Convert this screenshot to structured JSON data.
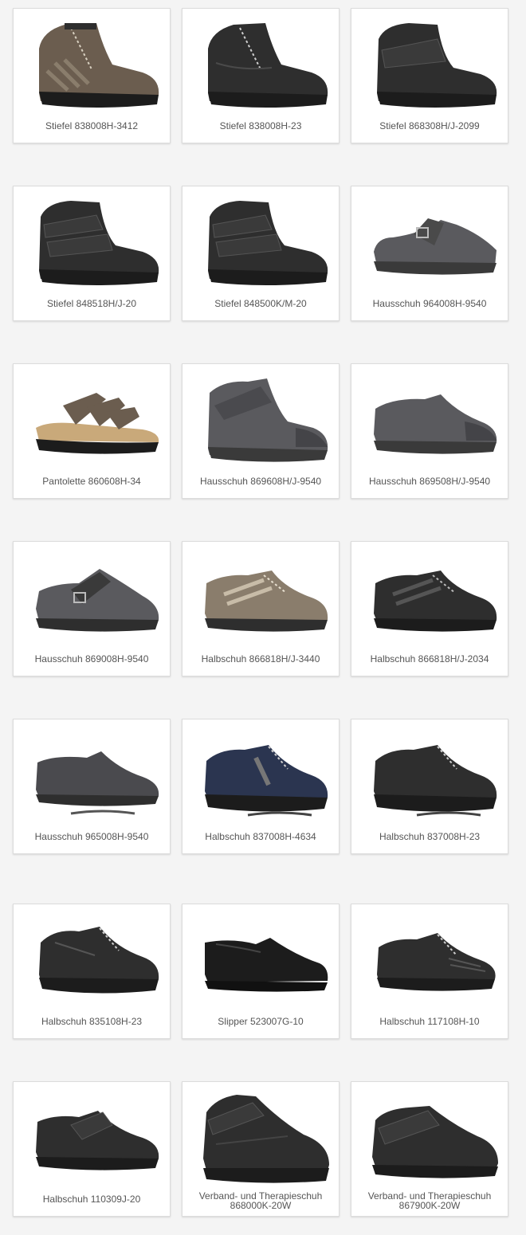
{
  "products": [
    {
      "name": "Stiefel 838008H-3412",
      "image": "brown-grey lace-up boot with side zip",
      "icon": "ankle-boot-lace-icon",
      "tone": "brown"
    },
    {
      "name": "Stiefel 838008H-23",
      "image": "black lace-up boot with side zip",
      "icon": "ankle-boot-lace-icon",
      "tone": "black"
    },
    {
      "name": "Stiefel 868308H/J-2099",
      "image": "black boot with wide velcro strap",
      "icon": "ankle-boot-strap-icon",
      "tone": "black"
    },
    {
      "name": "Stiefel 848518H/J-20",
      "image": "black boot with two velcro straps",
      "icon": "ankle-boot-strap-icon",
      "tone": "black"
    },
    {
      "name": "Stiefel 848500K/M-20",
      "image": "black boot with two velcro straps",
      "icon": "ankle-boot-strap-icon",
      "tone": "black"
    },
    {
      "name": "Hausschuh 964008H-9540",
      "image": "grey felt slipper with buckle strap",
      "icon": "slipper-buckle-icon",
      "tone": "felt"
    },
    {
      "name": "Pantolette 860608H-34",
      "image": "brown open sandal with three straps",
      "icon": "sandal-icon",
      "tone": "brown"
    },
    {
      "name": "Hausschuh 869608H/J-9540",
      "image": "grey felt high slipper with strap",
      "icon": "felt-boot-icon",
      "tone": "felt"
    },
    {
      "name": "Hausschuh 869508H/J-9540",
      "image": "grey felt slipper",
      "icon": "felt-slipper-icon",
      "tone": "felt"
    },
    {
      "name": "Hausschuh 869008H-9540",
      "image": "grey felt clog with buckle",
      "icon": "slipper-buckle-icon",
      "tone": "felt"
    },
    {
      "name": "Halbschuh 866818H/J-3440",
      "image": "taupe lace-up shoe",
      "icon": "lace-shoe-icon",
      "tone": "taupe"
    },
    {
      "name": "Halbschuh 866818H/J-2034",
      "image": "black lace-up shoe",
      "icon": "lace-shoe-icon",
      "tone": "black"
    },
    {
      "name": "Hausschuh 965008H-9540",
      "image": "dark felt slip-on slipper",
      "icon": "felt-slipper-icon",
      "tone": "felt"
    },
    {
      "name": "Halbschuh 837008H-4634",
      "image": "navy lace-up sneaker",
      "icon": "sneaker-icon",
      "tone": "navy"
    },
    {
      "name": "Halbschuh 837008H-23",
      "image": "black lace-up sneaker",
      "icon": "sneaker-icon",
      "tone": "black"
    },
    {
      "name": "Halbschuh 835108H-23",
      "image": "black lace-up shoe",
      "icon": "lace-shoe-icon",
      "tone": "black"
    },
    {
      "name": "Slipper 523007G-10",
      "image": "black leather loafer",
      "icon": "loafer-icon",
      "tone": "black"
    },
    {
      "name": "Halbschuh 117108H-10",
      "image": "black lace-up shoe",
      "icon": "lace-shoe-icon",
      "tone": "black"
    },
    {
      "name": "Halbschuh 110309J-20",
      "image": "black velcro shoe",
      "icon": "strap-shoe-icon",
      "tone": "black"
    },
    {
      "name_lines": [
        "Verband- und Therapieschuh",
        "868000K-20W"
      ],
      "image": "black therapy shoe with velcro strap",
      "icon": "therapy-shoe-icon",
      "tone": "black"
    },
    {
      "name_lines": [
        "Verband- und Therapieschuh",
        "867900K-20W"
      ],
      "image": "black therapy shoe with velcro strap",
      "icon": "therapy-shoe-icon",
      "tone": "black"
    }
  ],
  "colors": {
    "background": "#f4f4f4",
    "card": "#ffffff",
    "label": "#555555",
    "black_leather": "#2e2e2e",
    "brown_leather": "#6b5d4f",
    "felt": "#5a5a5e",
    "navy": "#2b3550",
    "taupe": "#8a7d6c",
    "sole": "#1c1c1c"
  }
}
